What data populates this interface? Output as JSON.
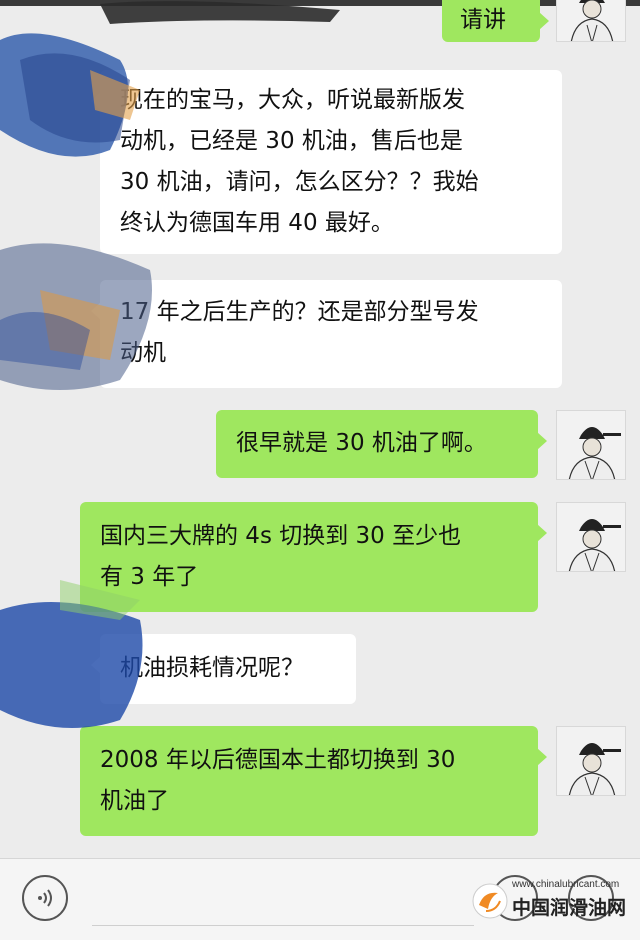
{
  "messages": [
    {
      "side": "right",
      "lines": [
        "请讲"
      ]
    },
    {
      "side": "left",
      "lines": [
        "现在的宝马，大众，听说最新版发",
        "动机，已经是 30 机油，售后也是",
        "30 机油，请问，怎么区分？？我始",
        "终认为德国车用 40 最好。"
      ]
    },
    {
      "side": "left",
      "lines": [
        "17 年之后生产的？还是部分型号发",
        "动机"
      ]
    },
    {
      "side": "right",
      "lines": [
        "很早就是 30 机油了啊。"
      ]
    },
    {
      "side": "right",
      "lines": [
        "国内三大牌的 4s 切换到 30 至少也",
        "有 3 年了"
      ]
    },
    {
      "side": "left",
      "lines": [
        "机油损耗情况呢？"
      ]
    },
    {
      "side": "right",
      "lines": [
        "2008 年以后德国本土都切换到 30",
        "机油了"
      ]
    }
  ],
  "footer": {
    "voice_icon": "voice-icon",
    "emoji_icon": "emoji-icon",
    "plus_icon": "plus-icon"
  },
  "watermark": {
    "url": "www.chinalubricant.com",
    "name": "中国润滑油网"
  },
  "colors": {
    "background": "#ececec",
    "bubble_sent": "#9fe75f",
    "bubble_received": "#ffffff"
  }
}
